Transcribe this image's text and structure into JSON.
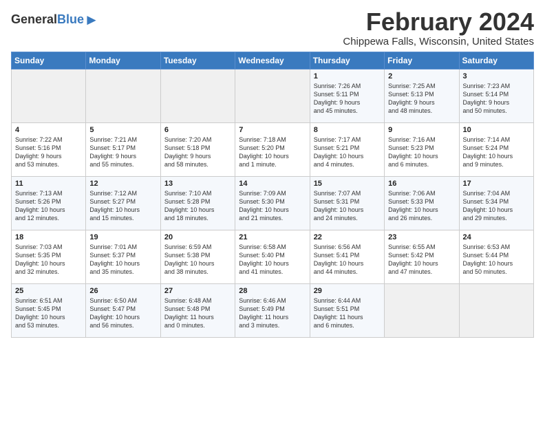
{
  "header": {
    "logo_general": "General",
    "logo_blue": "Blue",
    "month": "February 2024",
    "location": "Chippewa Falls, Wisconsin, United States"
  },
  "calendar": {
    "days_of_week": [
      "Sunday",
      "Monday",
      "Tuesday",
      "Wednesday",
      "Thursday",
      "Friday",
      "Saturday"
    ],
    "weeks": [
      [
        {
          "day": "",
          "info": ""
        },
        {
          "day": "",
          "info": ""
        },
        {
          "day": "",
          "info": ""
        },
        {
          "day": "",
          "info": ""
        },
        {
          "day": "1",
          "info": "Sunrise: 7:26 AM\nSunset: 5:11 PM\nDaylight: 9 hours\nand 45 minutes."
        },
        {
          "day": "2",
          "info": "Sunrise: 7:25 AM\nSunset: 5:13 PM\nDaylight: 9 hours\nand 48 minutes."
        },
        {
          "day": "3",
          "info": "Sunrise: 7:23 AM\nSunset: 5:14 PM\nDaylight: 9 hours\nand 50 minutes."
        }
      ],
      [
        {
          "day": "4",
          "info": "Sunrise: 7:22 AM\nSunset: 5:16 PM\nDaylight: 9 hours\nand 53 minutes."
        },
        {
          "day": "5",
          "info": "Sunrise: 7:21 AM\nSunset: 5:17 PM\nDaylight: 9 hours\nand 55 minutes."
        },
        {
          "day": "6",
          "info": "Sunrise: 7:20 AM\nSunset: 5:18 PM\nDaylight: 9 hours\nand 58 minutes."
        },
        {
          "day": "7",
          "info": "Sunrise: 7:18 AM\nSunset: 5:20 PM\nDaylight: 10 hours\nand 1 minute."
        },
        {
          "day": "8",
          "info": "Sunrise: 7:17 AM\nSunset: 5:21 PM\nDaylight: 10 hours\nand 4 minutes."
        },
        {
          "day": "9",
          "info": "Sunrise: 7:16 AM\nSunset: 5:23 PM\nDaylight: 10 hours\nand 6 minutes."
        },
        {
          "day": "10",
          "info": "Sunrise: 7:14 AM\nSunset: 5:24 PM\nDaylight: 10 hours\nand 9 minutes."
        }
      ],
      [
        {
          "day": "11",
          "info": "Sunrise: 7:13 AM\nSunset: 5:26 PM\nDaylight: 10 hours\nand 12 minutes."
        },
        {
          "day": "12",
          "info": "Sunrise: 7:12 AM\nSunset: 5:27 PM\nDaylight: 10 hours\nand 15 minutes."
        },
        {
          "day": "13",
          "info": "Sunrise: 7:10 AM\nSunset: 5:28 PM\nDaylight: 10 hours\nand 18 minutes."
        },
        {
          "day": "14",
          "info": "Sunrise: 7:09 AM\nSunset: 5:30 PM\nDaylight: 10 hours\nand 21 minutes."
        },
        {
          "day": "15",
          "info": "Sunrise: 7:07 AM\nSunset: 5:31 PM\nDaylight: 10 hours\nand 24 minutes."
        },
        {
          "day": "16",
          "info": "Sunrise: 7:06 AM\nSunset: 5:33 PM\nDaylight: 10 hours\nand 26 minutes."
        },
        {
          "day": "17",
          "info": "Sunrise: 7:04 AM\nSunset: 5:34 PM\nDaylight: 10 hours\nand 29 minutes."
        }
      ],
      [
        {
          "day": "18",
          "info": "Sunrise: 7:03 AM\nSunset: 5:35 PM\nDaylight: 10 hours\nand 32 minutes."
        },
        {
          "day": "19",
          "info": "Sunrise: 7:01 AM\nSunset: 5:37 PM\nDaylight: 10 hours\nand 35 minutes."
        },
        {
          "day": "20",
          "info": "Sunrise: 6:59 AM\nSunset: 5:38 PM\nDaylight: 10 hours\nand 38 minutes."
        },
        {
          "day": "21",
          "info": "Sunrise: 6:58 AM\nSunset: 5:40 PM\nDaylight: 10 hours\nand 41 minutes."
        },
        {
          "day": "22",
          "info": "Sunrise: 6:56 AM\nSunset: 5:41 PM\nDaylight: 10 hours\nand 44 minutes."
        },
        {
          "day": "23",
          "info": "Sunrise: 6:55 AM\nSunset: 5:42 PM\nDaylight: 10 hours\nand 47 minutes."
        },
        {
          "day": "24",
          "info": "Sunrise: 6:53 AM\nSunset: 5:44 PM\nDaylight: 10 hours\nand 50 minutes."
        }
      ],
      [
        {
          "day": "25",
          "info": "Sunrise: 6:51 AM\nSunset: 5:45 PM\nDaylight: 10 hours\nand 53 minutes."
        },
        {
          "day": "26",
          "info": "Sunrise: 6:50 AM\nSunset: 5:47 PM\nDaylight: 10 hours\nand 56 minutes."
        },
        {
          "day": "27",
          "info": "Sunrise: 6:48 AM\nSunset: 5:48 PM\nDaylight: 11 hours\nand 0 minutes."
        },
        {
          "day": "28",
          "info": "Sunrise: 6:46 AM\nSunset: 5:49 PM\nDaylight: 11 hours\nand 3 minutes."
        },
        {
          "day": "29",
          "info": "Sunrise: 6:44 AM\nSunset: 5:51 PM\nDaylight: 11 hours\nand 6 minutes."
        },
        {
          "day": "",
          "info": ""
        },
        {
          "day": "",
          "info": ""
        }
      ]
    ]
  }
}
